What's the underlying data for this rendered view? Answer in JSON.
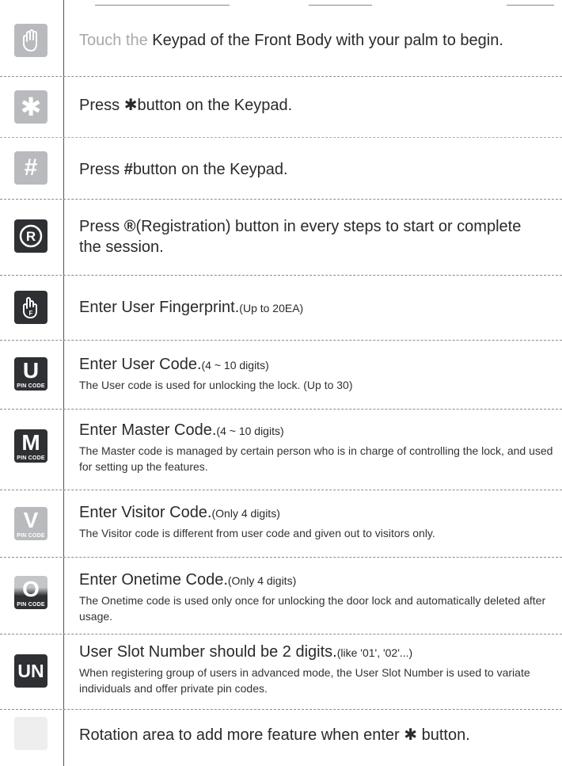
{
  "rows": [
    {
      "icon": "palm-icon",
      "faded": "Touch the",
      "text": " Keypad of the Front Body with your palm to begin."
    },
    {
      "icon": "star-icon",
      "pre": "Press ",
      "glyph": "✱",
      "text": "button on the Keypad."
    },
    {
      "icon": "hash-icon",
      "pre": "Press ",
      "glyph": "#",
      "text": "button on the Keypad."
    },
    {
      "icon": "registration-icon",
      "pre": "Press ",
      "glyph": "®",
      "text": "(Registration) button in every steps to start or complete the session."
    },
    {
      "icon": "fingerprint-icon",
      "text": "Enter User Fingerprint.",
      "note": "(Up to 20EA)"
    },
    {
      "icon": "user-code-icon",
      "letter": "U",
      "pin": "PIN CODE",
      "text": "Enter User Code.",
      "note": "(4 ~ 10 digits)",
      "sub": "The User code is used for unlocking the lock. (Up to 30)"
    },
    {
      "icon": "master-code-icon",
      "letter": "M",
      "pin": "PIN CODE",
      "text": "Enter Master Code.",
      "note": "(4 ~ 10 digits)",
      "sub": "The Master code is managed by certain person who is in charge of controlling the lock, and used for setting up the features."
    },
    {
      "icon": "visitor-code-icon",
      "letter": "V",
      "pin": "PIN CODE",
      "text": "Enter Visitor Code.",
      "note": "(Only 4 digits)",
      "sub": "The Visitor code is different from user code and given out to visitors only."
    },
    {
      "icon": "onetime-code-icon",
      "letter": "O",
      "pin": "PIN CODE",
      "text": "Enter Onetime Code.",
      "note": "(Only 4 digits)",
      "sub": "The Onetime code is used only once for unlocking the door lock and automatically deleted after usage."
    },
    {
      "icon": "user-slot-icon",
      "letter": "UN",
      "text": "User Slot Number should be 2 digits.",
      "note": "(like '01', '02'...)",
      "sub": "When registering group of users in advanced mode, the User Slot Number is used to variate individuals and offer private pin codes."
    },
    {
      "icon": "rotation-area-icon",
      "text": "Rotation area to add more feature when enter ",
      "glyph": "✱",
      "post": " button."
    }
  ]
}
